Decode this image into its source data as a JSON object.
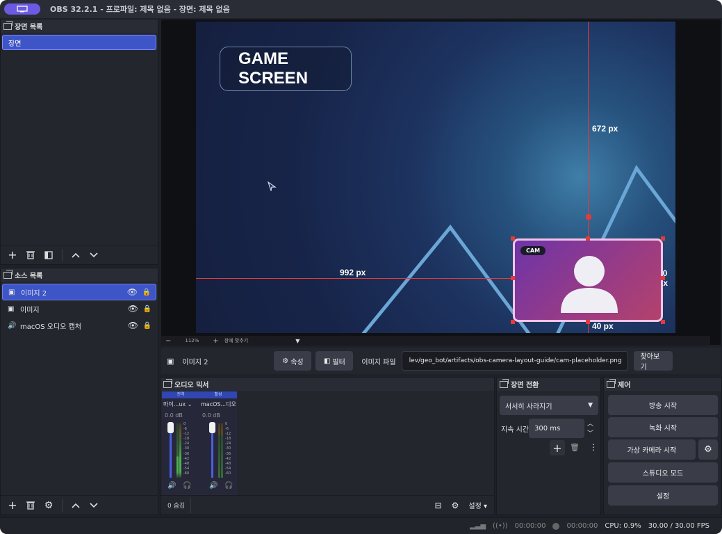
{
  "window": {
    "title": "OBS 32.2.1 - 프로파일: 제목 없음 - 장면: 제목 없음"
  },
  "scenes": {
    "header": "장면 목록",
    "items": [
      "장면"
    ]
  },
  "sources": {
    "header": "소스 목록",
    "items": [
      {
        "label": "이미지 2",
        "icon": "image-icon",
        "selected": true
      },
      {
        "label": "이미지",
        "icon": "image-icon",
        "selected": false
      },
      {
        "label": "macOS 오디오 캡처",
        "icon": "speaker-icon",
        "selected": false
      }
    ]
  },
  "preview": {
    "game_label": "GAME SCREEN",
    "cam_tag": "CAM",
    "guide_top": "672 px",
    "guide_left": "992 px",
    "guide_right": "40 px",
    "guide_bottom": "40 px",
    "zoom": "112%",
    "zoom_mode": "창에 맞추기"
  },
  "properties": {
    "source_name": "이미지 2",
    "props_button": "속성",
    "filter_button": "필터",
    "file_label": "이미지 파일",
    "file_path": "lev/geo_bot/artifacts/obs-camera-layout-guide/cam-placeholder.png",
    "browse_button": "찾아보기"
  },
  "mixer": {
    "header": "오디오 믹서",
    "channels": [
      {
        "tag": "전역",
        "name": "마이...ux",
        "db": "0.0 dB"
      },
      {
        "tag": "활성",
        "name": "macOS...디오 캡처",
        "db": "0.0 dB"
      }
    ],
    "scale": [
      "0",
      "-6",
      "-12",
      "-18",
      "-24",
      "-30",
      "-36",
      "-42",
      "-48",
      "-54",
      "-60"
    ],
    "footer_count": "0 숨김",
    "settings_label": "설정"
  },
  "transitions": {
    "header": "장면 전환",
    "selected": "서서히 사라지기",
    "duration_label": "지속 시간",
    "duration_value": "300 ms"
  },
  "controls": {
    "header": "제어",
    "start_stream": "방송 시작",
    "start_record": "녹화 시작",
    "virtual_camera": "가상 카메라 시작",
    "studio_mode": "스튜디오 모드",
    "settings": "설정"
  },
  "status": {
    "stream_time": "00:00:00",
    "record_time": "00:00:00",
    "cpu": "CPU: 0.9%",
    "fps": "30.00 / 30.00 FPS"
  },
  "colors": {
    "accent": "#3d55c7",
    "guide": "#e23b3b",
    "title_pill": "#6a5be2"
  }
}
